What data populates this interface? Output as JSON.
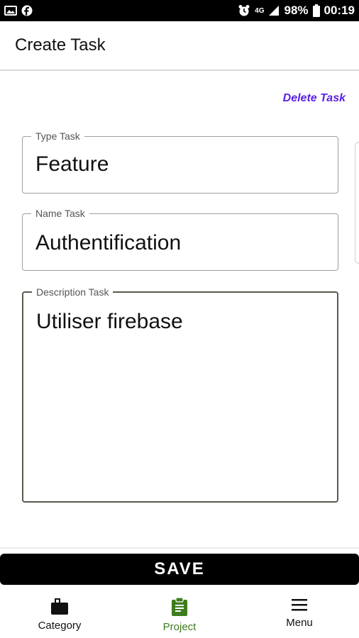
{
  "status_bar": {
    "battery": "98%",
    "time": "00:19",
    "network": "4G",
    "icons": [
      "image-icon",
      "facebook-icon",
      "alarm-icon",
      "network-4g-icon",
      "signal-icon",
      "battery-icon"
    ]
  },
  "app_bar": {
    "title": "Create Task"
  },
  "actions": {
    "delete_label": "Delete Task",
    "delete_color": "#5b21e6"
  },
  "form": {
    "type_task": {
      "label": "Type Task",
      "value": "Feature"
    },
    "name_task": {
      "label": "Name Task",
      "value": "Authentification"
    },
    "description_task": {
      "label": "Description Task",
      "value": "Utiliser firebase"
    }
  },
  "save": {
    "label": "SAVE"
  },
  "bottom_nav": {
    "items": [
      {
        "label": "Category",
        "icon": "category-icon",
        "active": false
      },
      {
        "label": "Project",
        "icon": "clipboard-icon",
        "active": true
      },
      {
        "label": "Menu",
        "icon": "menu-icon",
        "active": false
      }
    ],
    "active_color": "#3e7d1e"
  }
}
